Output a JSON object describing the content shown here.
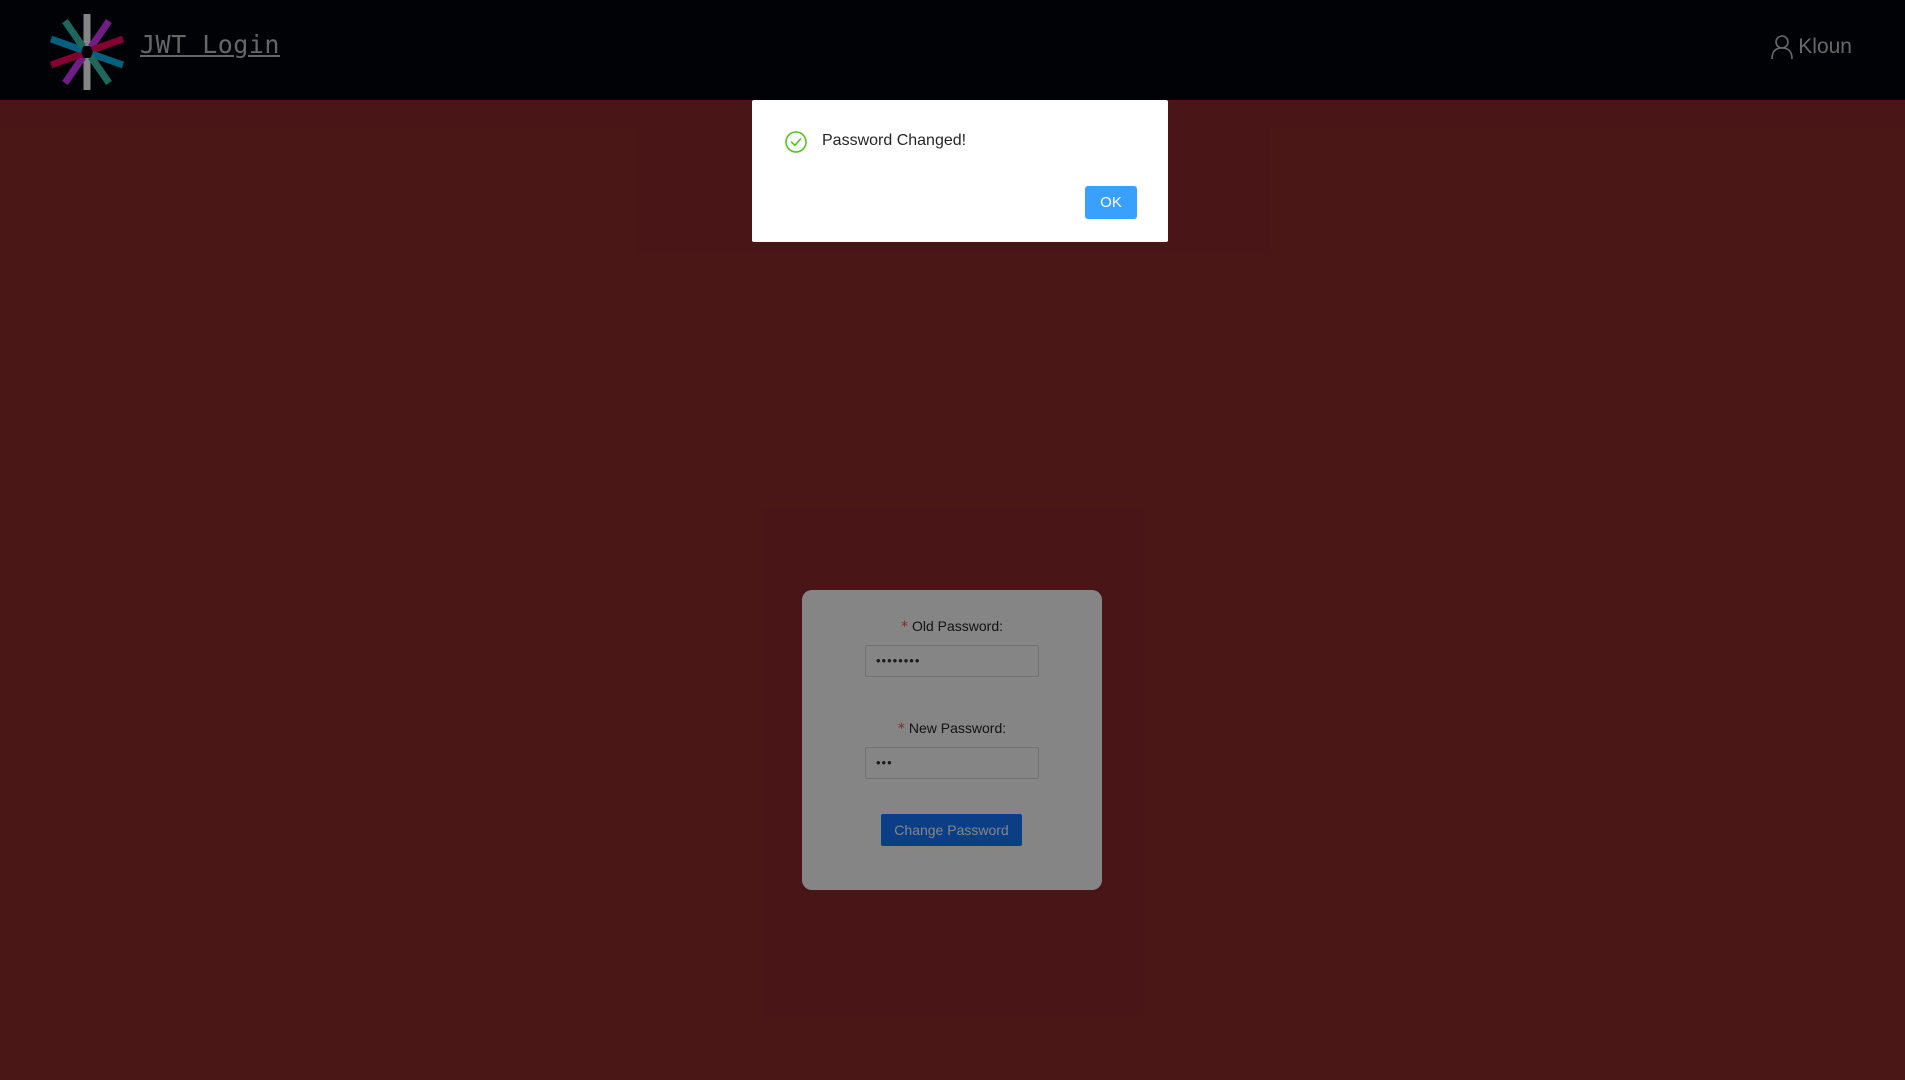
{
  "header": {
    "brand": "JWT Login",
    "logo_icon": "jwt-logo-icon",
    "user_icon": "user-icon",
    "username": "Kloun"
  },
  "form": {
    "old_password": {
      "required_mark": "*",
      "label": "Old Password:",
      "value": "••••••••"
    },
    "new_password": {
      "required_mark": "*",
      "label": "New Password:",
      "value": "•••"
    },
    "submit_label": "Change Password"
  },
  "modal": {
    "icon": "check-circle-icon",
    "message": "Password Changed!",
    "ok_label": "OK"
  },
  "colors": {
    "header_bg": "#00050a",
    "page_bg": "#8e2a2b",
    "primary": "#1677ff",
    "success": "#52c41a"
  }
}
